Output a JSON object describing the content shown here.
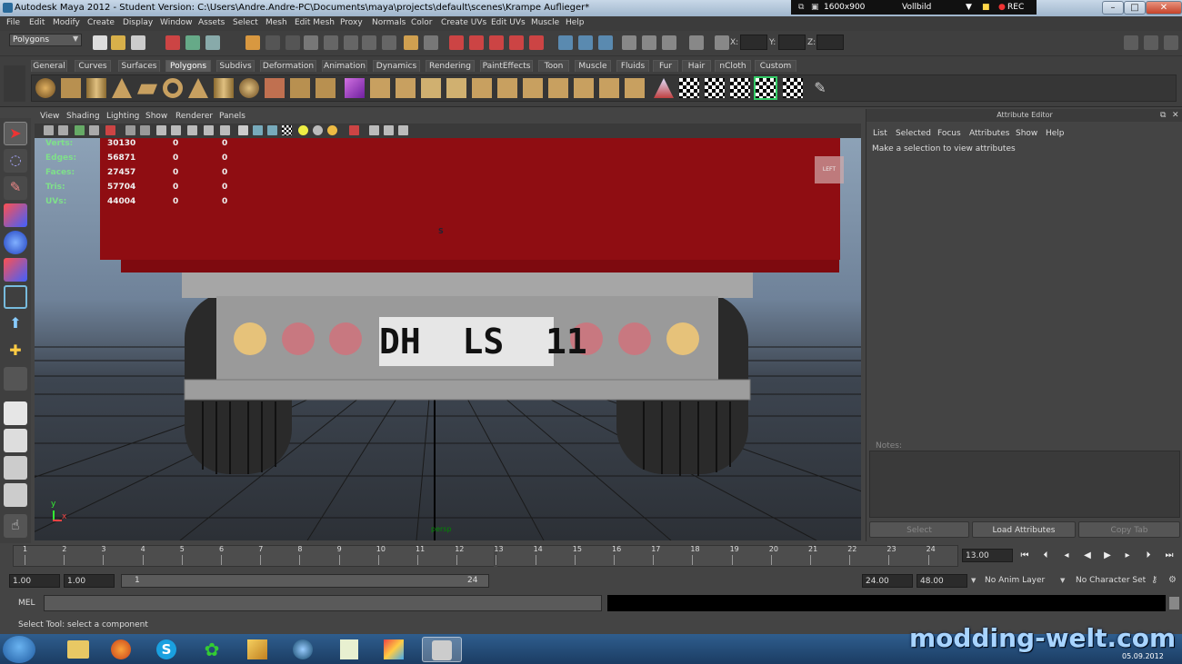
{
  "window": {
    "title": "Autodesk Maya 2012 - Student Version: C:\\Users\\Andre.Andre-PC\\Documents\\maya\\projects\\default\\scenes\\Krampe Auflieger*"
  },
  "recorder": {
    "resolution": "1600x900",
    "mode": "Vollbild",
    "rec": "REC"
  },
  "menubar": [
    "File",
    "Edit",
    "Modify",
    "Create",
    "Display",
    "Window",
    "Assets",
    "Select",
    "Mesh",
    "Edit Mesh",
    "Proxy",
    "Normals",
    "Color",
    "Create UVs",
    "Edit UVs",
    "Muscle",
    "Help"
  ],
  "status_line": {
    "mode": "Polygons",
    "x_label": "X:",
    "y_label": "Y:",
    "z_label": "Z:"
  },
  "shelf_tabs": [
    "General",
    "Curves",
    "Surfaces",
    "Polygons",
    "Subdivs",
    "Deformation",
    "Animation",
    "Dynamics",
    "Rendering",
    "PaintEffects",
    "Toon",
    "Muscle",
    "Fluids",
    "Fur",
    "Hair",
    "nCloth",
    "Custom"
  ],
  "shelf_active": "Polygons",
  "viewport_menu": [
    "View",
    "Shading",
    "Lighting",
    "Show",
    "Renderer",
    "Panels"
  ],
  "hud": {
    "rows": [
      {
        "label": "Verts:",
        "v1": "30130",
        "v2": "0",
        "v3": "0"
      },
      {
        "label": "Edges:",
        "v1": "56871",
        "v2": "0",
        "v3": "0"
      },
      {
        "label": "Faces:",
        "v1": "27457",
        "v2": "0",
        "v3": "0"
      },
      {
        "label": "Tris:",
        "v1": "57704",
        "v2": "0",
        "v3": "0"
      },
      {
        "label": "UVs:",
        "v1": "44004",
        "v2": "0",
        "v3": "0"
      }
    ],
    "camera": "persp",
    "viewcube": "LEFT",
    "s_marker": "S",
    "axis_y": "y",
    "axis_x": "x"
  },
  "license_plate": "DH  LS  11",
  "attribute_editor": {
    "title": "Attribute Editor",
    "menu": [
      "List",
      "Selected",
      "Focus",
      "Attributes",
      "Show",
      "Help"
    ],
    "message": "Make a selection to view attributes",
    "notes_label": "Notes:",
    "buttons": [
      "Select",
      "Load Attributes",
      "Copy Tab"
    ]
  },
  "timeline": {
    "ticks": [
      "1",
      "2",
      "3",
      "4",
      "5",
      "6",
      "7",
      "8",
      "9",
      "10",
      "11",
      "12",
      "13",
      "14",
      "15",
      "16",
      "17",
      "18",
      "19",
      "20",
      "21",
      "22",
      "23",
      "24"
    ],
    "current_frame": "13.00"
  },
  "range": {
    "start": "1.00",
    "inner_start": "1.00",
    "slider_left": "1",
    "slider_right": "24",
    "end": "24.00",
    "outer_end": "48.00",
    "anim_layer": "No Anim Layer",
    "char_set": "No Character Set"
  },
  "command": {
    "label": "MEL"
  },
  "help_line": "Select Tool: select a component",
  "watermark": "modding-welt.com",
  "clock": {
    "date": "05.09.2012"
  },
  "colors": {
    "trailer_red": "#8f0d12",
    "chassis_gray": "#9a9a9a",
    "lamp_yellow": "#e6c27a",
    "lamp_pink": "#c87880"
  }
}
